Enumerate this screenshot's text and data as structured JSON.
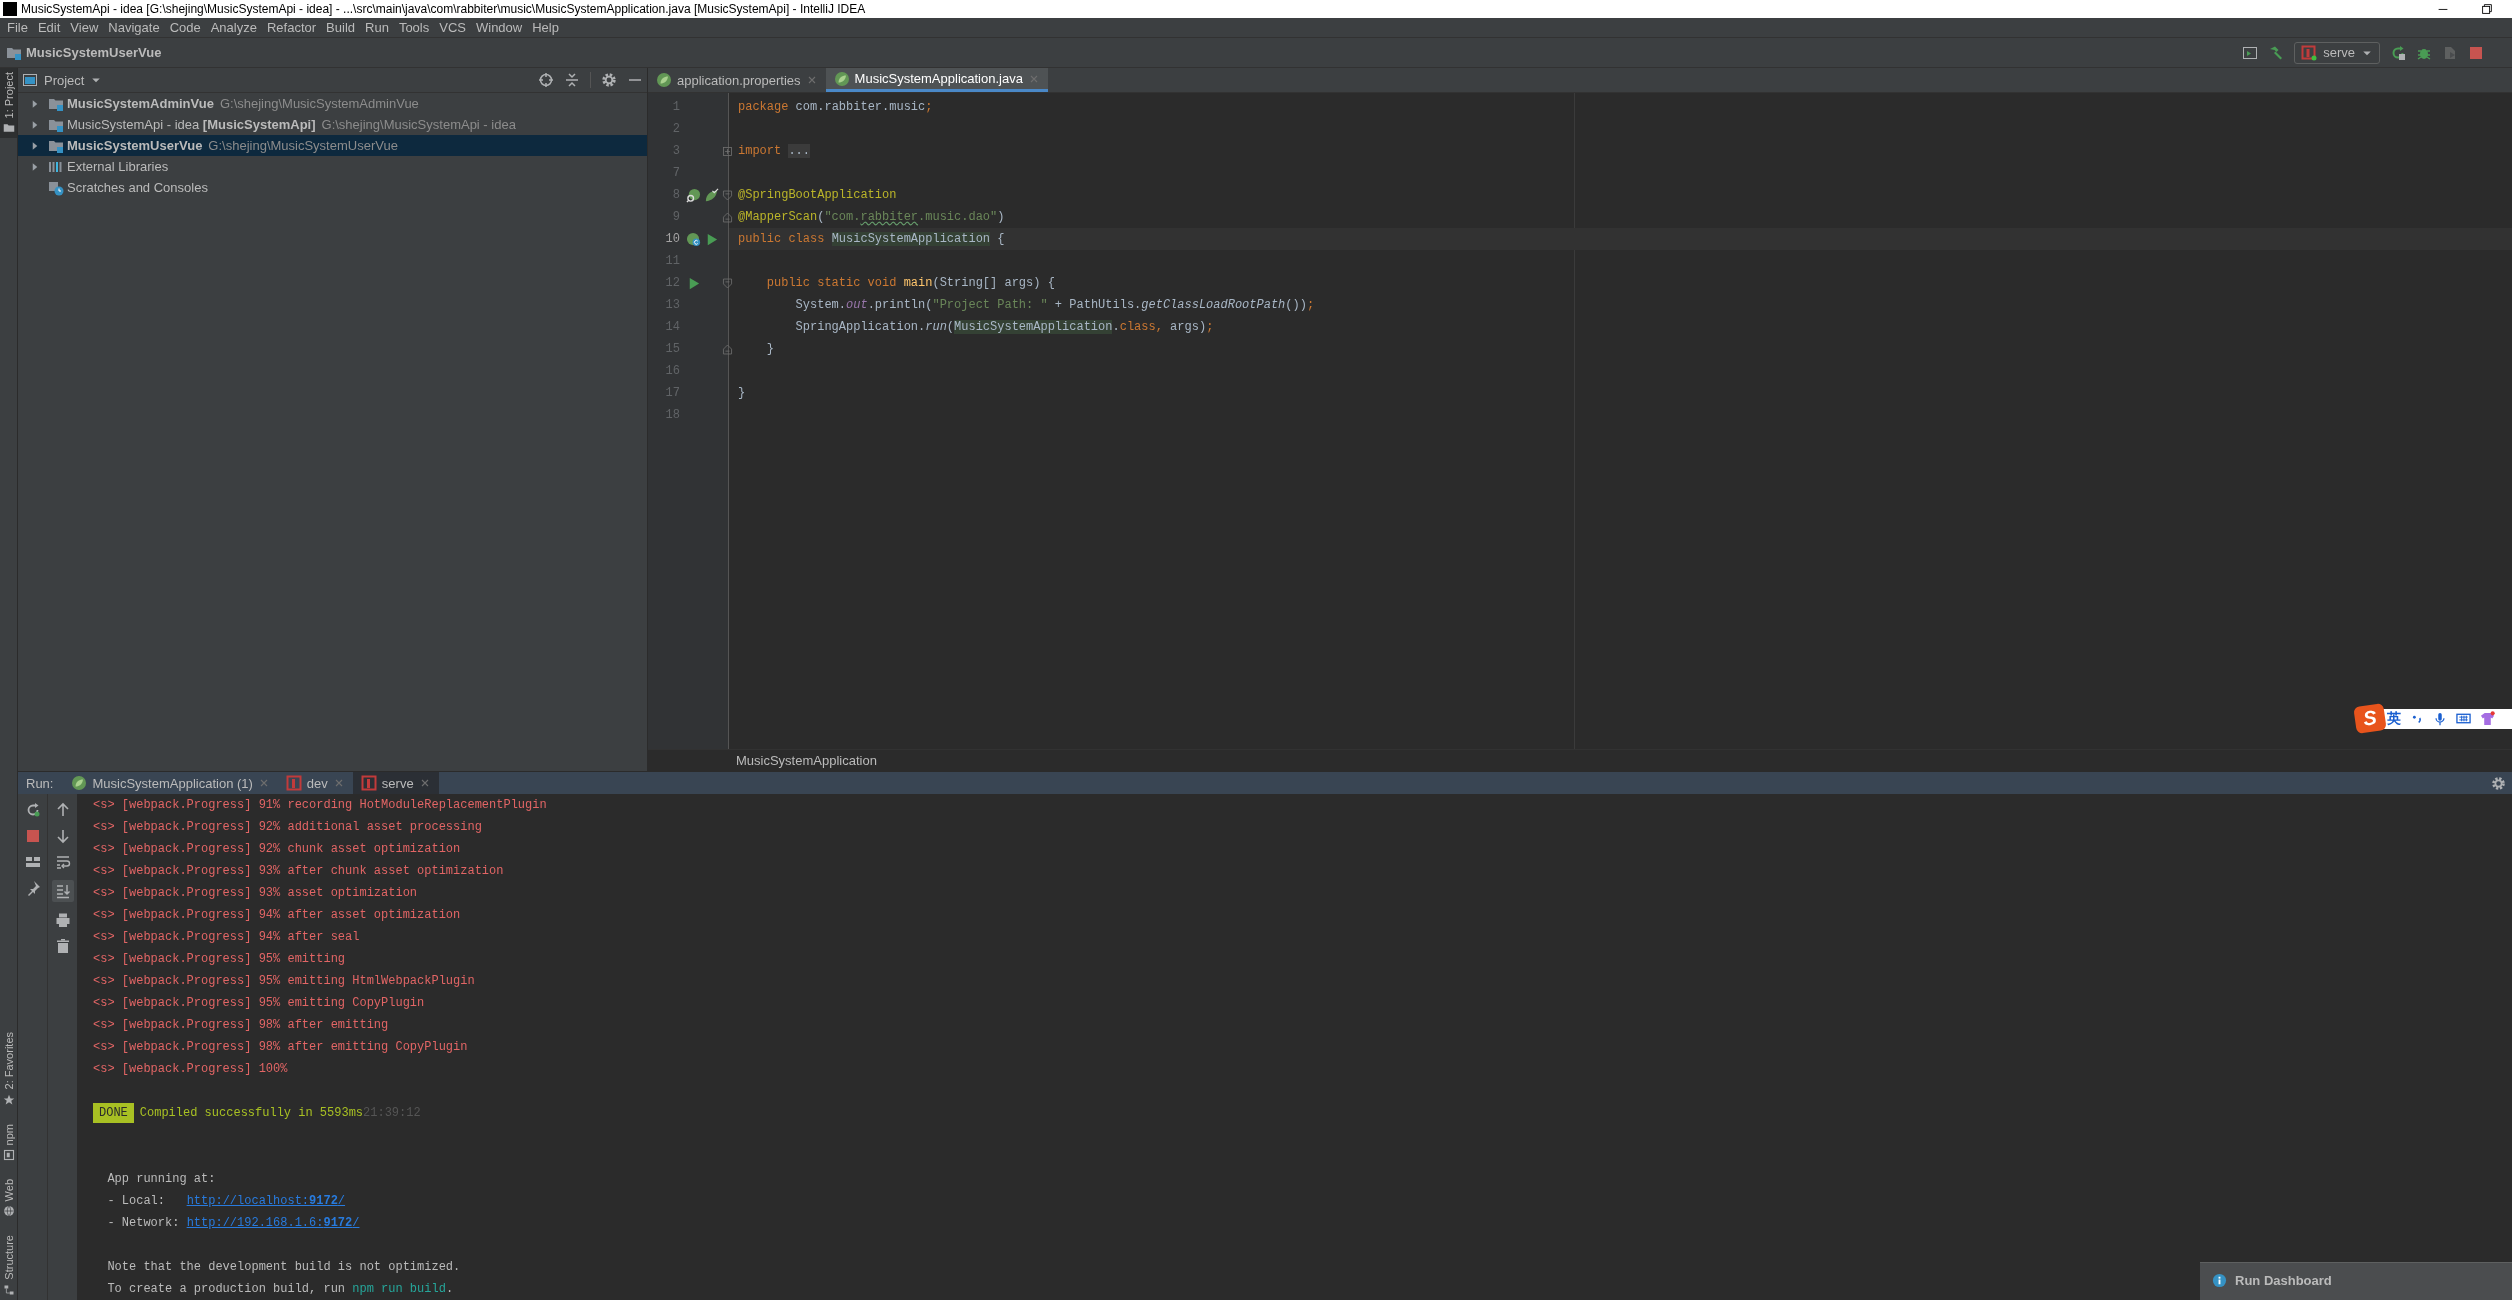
{
  "window": {
    "title": "MusicSystemApi - idea [G:\\shejing\\MusicSystemApi - idea] - ...\\src\\main\\java\\com\\rabbiter\\music\\MusicSystemApplication.java [MusicSystemApi] - IntelliJ IDEA"
  },
  "menu": [
    "File",
    "Edit",
    "View",
    "Navigate",
    "Code",
    "Analyze",
    "Refactor",
    "Build",
    "Run",
    "Tools",
    "VCS",
    "Window",
    "Help"
  ],
  "navbar": {
    "project": "MusicSystemUserVue",
    "run_config": "serve"
  },
  "tool_stripe": {
    "top": [
      {
        "label": "1: Project",
        "selected": true
      }
    ],
    "bottom": [
      {
        "kind": "favorites",
        "label": "2: Favorites",
        "selected": false
      },
      {
        "kind": "npm",
        "label": "npm",
        "selected": false
      },
      {
        "kind": "web",
        "label": "Web",
        "selected": false
      },
      {
        "kind": "structure",
        "label": "Structure",
        "selected": false
      }
    ]
  },
  "project_panel": {
    "title": "Project",
    "tree": [
      {
        "kind": "module",
        "name": "MusicSystemAdminVue",
        "path": "G:\\shejing\\MusicSystemAdminVue",
        "bold": true,
        "expanded": false,
        "selected": false
      },
      {
        "kind": "module",
        "name": "MusicSystemApi - idea **[MusicSystemApi]**",
        "path": "G:\\shejing\\MusicSystemApi - idea",
        "bold": false,
        "expanded": false,
        "selected": false
      },
      {
        "kind": "module",
        "name": "MusicSystemUserVue",
        "path": "G:\\shejing\\MusicSystemUserVue",
        "bold": true,
        "expanded": false,
        "selected": true
      },
      {
        "kind": "libraries",
        "name": "External Libraries",
        "bold": false,
        "expanded": false,
        "selected": false
      },
      {
        "kind": "scratches",
        "name": "Scratches and Consoles",
        "bold": false,
        "selected": false
      }
    ]
  },
  "editor": {
    "tabs": [
      {
        "label": "application.properties",
        "selected": false
      },
      {
        "label": "MusicSystemApplication.java",
        "selected": true
      }
    ],
    "lines": [
      {
        "number": "1",
        "current": false,
        "tokens": [
          {
            "kind": "keyword",
            "text": "package"
          },
          {
            "kind": "plain",
            "text": " com.rabbiter.music"
          },
          {
            "kind": "keyword",
            "text": ";"
          }
        ]
      },
      {
        "number": "2",
        "current": false
      },
      {
        "number": "3",
        "current": false,
        "fold": {
          "kind": "expand"
        },
        "tokens": [
          {
            "kind": "keyword",
            "text": "import "
          },
          {
            "kind": "folded",
            "text": "..."
          }
        ]
      },
      {
        "number": "7",
        "current": false
      },
      {
        "number": "8",
        "current": false,
        "fold": {
          "kind": "open"
        },
        "gutter": [
          {
            "kind": "spring_usages"
          },
          {
            "kind": "spring_beans"
          }
        ],
        "tokens": [
          {
            "kind": "annotation",
            "text": "@SpringBootApplication"
          }
        ]
      },
      {
        "number": "9",
        "current": false,
        "fold": {
          "kind": "close"
        },
        "tokens": [
          {
            "kind": "annotation",
            "text": "@MapperScan"
          },
          {
            "kind": "plain",
            "text": "("
          },
          {
            "kind": "string",
            "text": "\"com."
          },
          {
            "kind": "string_typo",
            "text": "rabbiter"
          },
          {
            "kind": "string",
            "text": ".music.dao\""
          },
          {
            "kind": "plain",
            "text": ")"
          }
        ]
      },
      {
        "number": "10",
        "current": true,
        "gutter": [
          {
            "kind": "spring_bean"
          },
          {
            "kind": "run"
          }
        ],
        "tokens": [
          {
            "kind": "keyword",
            "text": "public class "
          },
          {
            "kind": "usage",
            "text": "MusicSystemApplication"
          },
          {
            "kind": "plain",
            "text": " {"
          }
        ]
      },
      {
        "number": "11",
        "current": false
      },
      {
        "number": "12",
        "current": false,
        "fold": {
          "kind": "open"
        },
        "gutter": [
          {
            "kind": "run"
          }
        ],
        "tokens": [
          {
            "kind": "keyword",
            "text": "    public static void "
          },
          {
            "kind": "method",
            "text": "main"
          },
          {
            "kind": "plain",
            "text": "(String[] args) {"
          }
        ]
      },
      {
        "number": "13",
        "current": false,
        "tokens": [
          {
            "kind": "plain",
            "text": "        System."
          },
          {
            "kind": "field",
            "text": "out"
          },
          {
            "kind": "plain",
            "text": ".println("
          },
          {
            "kind": "string",
            "text": "\"Project Path: \""
          },
          {
            "kind": "plain",
            "text": " + PathUtils."
          },
          {
            "kind": "static_call",
            "text": "getClassLoadRootPath"
          },
          {
            "kind": "plain",
            "text": "())"
          },
          {
            "kind": "keyword",
            "text": ";"
          }
        ]
      },
      {
        "number": "14",
        "current": false,
        "tokens": [
          {
            "kind": "plain",
            "text": "        SpringApplication."
          },
          {
            "kind": "static_call",
            "text": "run"
          },
          {
            "kind": "plain",
            "text": "("
          },
          {
            "kind": "usage",
            "text": "MusicSystemApplication"
          },
          {
            "kind": "plain",
            "text": "."
          },
          {
            "kind": "keyword",
            "text": "class, "
          },
          {
            "kind": "plain",
            "text": "args)"
          },
          {
            "kind": "keyword",
            "text": ";"
          }
        ]
      },
      {
        "number": "15",
        "current": false,
        "fold": {
          "kind": "close"
        },
        "tokens": [
          {
            "kind": "plain",
            "text": "    }"
          }
        ]
      },
      {
        "number": "16",
        "current": false
      },
      {
        "number": "17",
        "current": false,
        "tokens": [
          {
            "kind": "plain",
            "text": "}"
          }
        ]
      },
      {
        "number": "18",
        "current": false
      }
    ],
    "breadcrumb": "MusicSystemApplication"
  },
  "run_panel": {
    "label": "Run:",
    "autoscroll": true,
    "tabs": [
      {
        "kind": "spring",
        "label": "MusicSystemApplication (1)",
        "selected": false
      },
      {
        "kind": "npm",
        "label": "dev",
        "selected": false
      },
      {
        "kind": "npm",
        "label": "serve",
        "selected": true
      }
    ],
    "console": [
      {
        "kind": "progress",
        "text": "<s> [webpack.Progress] 91% recording HotModuleReplacementPlugin"
      },
      {
        "kind": "progress",
        "text": "<s> [webpack.Progress] 92% additional asset processing"
      },
      {
        "kind": "progress",
        "text": "<s> [webpack.Progress] 92% chunk asset optimization"
      },
      {
        "kind": "progress",
        "text": "<s> [webpack.Progress] 93% after chunk asset optimization"
      },
      {
        "kind": "progress",
        "text": "<s> [webpack.Progress] 93% asset optimization"
      },
      {
        "kind": "progress",
        "text": "<s> [webpack.Progress] 94% after asset optimization"
      },
      {
        "kind": "progress",
        "text": "<s> [webpack.Progress] 94% after seal"
      },
      {
        "kind": "progress",
        "text": "<s> [webpack.Progress] 95% emitting"
      },
      {
        "kind": "progress",
        "text": "<s> [webpack.Progress] 95% emitting HtmlWebpackPlugin"
      },
      {
        "kind": "progress",
        "text": "<s> [webpack.Progress] 95% emitting CopyPlugin"
      },
      {
        "kind": "progress",
        "text": "<s> [webpack.Progress] 98% after emitting"
      },
      {
        "kind": "progress",
        "text": "<s> [webpack.Progress] 98% after emitting CopyPlugin"
      },
      {
        "kind": "progress",
        "text": "<s> [webpack.Progress] 100%"
      },
      {
        "kind": "blank"
      },
      {
        "kind": "done",
        "badge": "DONE",
        "text": "Compiled successfully in 5593ms",
        "time": "21:39:12"
      },
      {
        "kind": "blank"
      },
      {
        "kind": "blank"
      },
      {
        "kind": "plain",
        "text": "  App running at:"
      },
      {
        "kind": "link",
        "label": "  - Local:   ",
        "url": "http://localhost:**9172**/"
      },
      {
        "kind": "link",
        "label": "  - Network: ",
        "url": "http://192.168.1.6:**9172**/"
      },
      {
        "kind": "blank"
      },
      {
        "kind": "plain",
        "text": "  Note that the development build is not optimized."
      },
      {
        "kind": "command",
        "text": "  To create a production build, run ",
        "command": "npm run build",
        "tail": "."
      }
    ]
  },
  "ime": {
    "logo": "S",
    "mode": "英"
  },
  "notification": {
    "title": "Run Dashboard"
  }
}
